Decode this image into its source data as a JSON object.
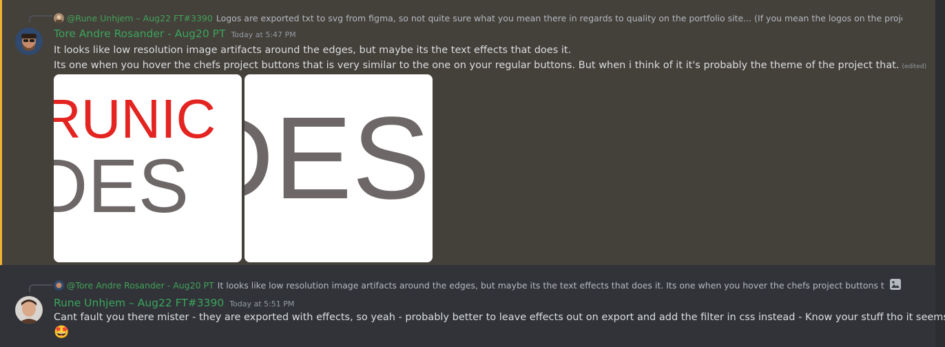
{
  "messages": [
    {
      "reply": {
        "author": "@Rune Unhjem – Aug22 FT#3390",
        "text": "Logos are exported txt to svg from figma, so not quite sure what you mean there in regards to quality on the portfolio site... (If you mean the logos on the projects there are"
      },
      "author": "Tore Andre Rosander - Aug20 PT",
      "timestamp": "Today at 5:47 PM",
      "lines": [
        "It looks like low resolution image artifacts around the edges, but maybe its the text effects that does it.",
        "Its one when you hover the chefs project buttons that is very similar to the one on your regular buttons. But when i think of it it's probably the theme of the project that."
      ],
      "edited_label": "(edited)",
      "attachments": [
        {
          "name": "attachment-runic-design",
          "text_top": "RUNIC",
          "text_bottom": "DES"
        },
        {
          "name": "attachment-des-zoomed",
          "text": "DES"
        }
      ]
    },
    {
      "reply": {
        "author": "@Tore Andre Rosander - Aug20 PT",
        "text": "It looks like low resolution image artifacts around the edges, but maybe its the text effects that does it. Its one when you hover the chefs project buttons that is very"
      },
      "author": "Rune Unhjem – Aug22 FT#3390",
      "timestamp": "Today at 5:51 PM",
      "text": "Cant fault you there mister - they are exported with effects, so yeah - probably better to leave effects out on export and add the filter in css instead - Know your stuff tho it seems",
      "emoji": "🤩"
    }
  ],
  "colors": {
    "role_green": "#3ba55d",
    "reply_green": "#43a25a",
    "highlight_bg": "#44403a",
    "mention_bar": "#f0b232",
    "logo_red": "#e32420",
    "logo_gray": "#6e6767"
  },
  "icons": {
    "image_attachment": "image-icon"
  }
}
